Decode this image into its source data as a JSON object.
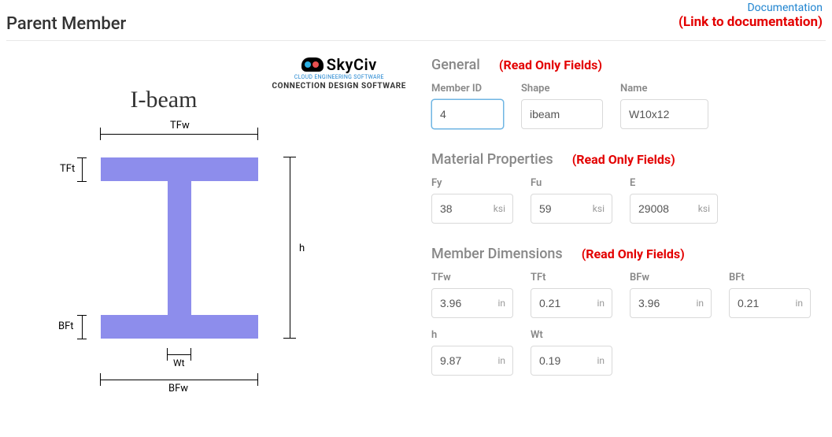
{
  "header": {
    "title": "Parent Member",
    "doc_link": "Documentation",
    "doc_annot": "(Link to documentation)"
  },
  "brand": {
    "name": "SkyCiv",
    "tagline": "CLOUD ENGINEERING SOFTWARE",
    "product": "CONNECTION DESIGN SOFTWARE"
  },
  "diagram": {
    "title": "I-beam",
    "labels": {
      "tfw": "TFw",
      "tft": "TFt",
      "bft": "BFt",
      "bfw": "BFw",
      "wt": "Wt",
      "h": "h"
    }
  },
  "annotations": {
    "readonly": "(Read Only Fields)"
  },
  "sections": {
    "general": {
      "title": "General",
      "fields": {
        "member_id": {
          "label": "Member ID",
          "value": "4"
        },
        "shape": {
          "label": "Shape",
          "value": "ibeam"
        },
        "name": {
          "label": "Name",
          "value": "W10x12"
        }
      }
    },
    "material": {
      "title": "Material Properties",
      "fields": {
        "fy": {
          "label": "Fy",
          "value": "38",
          "unit": "ksi"
        },
        "fu": {
          "label": "Fu",
          "value": "59",
          "unit": "ksi"
        },
        "e": {
          "label": "E",
          "value": "29008",
          "unit": "ksi"
        }
      }
    },
    "dims": {
      "title": "Member Dimensions",
      "fields": {
        "tfw": {
          "label": "TFw",
          "value": "3.96",
          "unit": "in"
        },
        "tft": {
          "label": "TFt",
          "value": "0.21",
          "unit": "in"
        },
        "bfw": {
          "label": "BFw",
          "value": "3.96",
          "unit": "in"
        },
        "bft": {
          "label": "BFt",
          "value": "0.21",
          "unit": "in"
        },
        "h": {
          "label": "h",
          "value": "9.87",
          "unit": "in"
        },
        "wt": {
          "label": "Wt",
          "value": "0.19",
          "unit": "in"
        }
      }
    }
  }
}
